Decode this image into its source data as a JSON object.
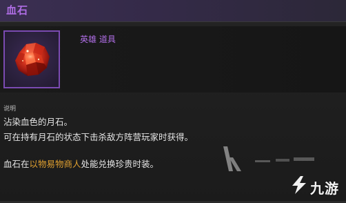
{
  "item": {
    "name": "血石",
    "rarity_label": "英雄 道具",
    "icon": "red-gem-icon"
  },
  "description": {
    "section_label": "说明",
    "line1": "沾染血色的月石。",
    "line2": "可在持有月石的状态下击杀敌方阵营玩家时获得。",
    "line3_prefix": "血石在",
    "line3_highlight": "以物易物商人",
    "line3_suffix": "处能兑换珍贵时装。"
  },
  "watermark": {
    "text": "九游",
    "logo": "jiuyou-logo-icon"
  },
  "colors": {
    "title": "#b06ee6",
    "rarity": "#b06ee6",
    "icon_border": "#7b4bb2",
    "highlight": "#e0a030",
    "text": "#e6e6e6"
  }
}
